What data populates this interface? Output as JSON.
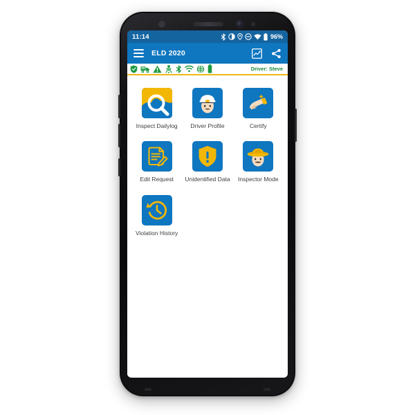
{
  "device": {
    "type": "android-smartphone",
    "frame_color": "#0d0d0f"
  },
  "status_bar": {
    "time": "11:14",
    "battery_percent": "96%",
    "icons": [
      "bluetooth-icon",
      "brightness-icon",
      "location-icon",
      "do-not-disturb-icon",
      "wifi-icon",
      "battery-icon"
    ],
    "background_color": "#1464a0"
  },
  "app_bar": {
    "menu_icon": "hamburger-menu-icon",
    "title": "ELD 2020",
    "actions": [
      {
        "name": "chart-image-icon",
        "label": "Chart"
      },
      {
        "name": "share-icon",
        "label": "Share"
      }
    ],
    "background_color": "#0f76c0"
  },
  "status_strip": {
    "driver_label": "Driver: Steve",
    "accent_color": "#188a3c",
    "divider_color": "#f0b816",
    "icons": [
      {
        "name": "shield-icon",
        "state": "ok"
      },
      {
        "name": "truck-icon",
        "state": "ok"
      },
      {
        "name": "warning-triangle-icon",
        "state": "ok"
      },
      {
        "name": "eld-connection-icon",
        "state": "ok"
      },
      {
        "name": "bluetooth-icon",
        "state": "ok"
      },
      {
        "name": "wifi-icon",
        "state": "ok"
      },
      {
        "name": "globe-icon",
        "state": "ok"
      },
      {
        "name": "battery-icon",
        "state": "ok"
      }
    ]
  },
  "main": {
    "tile_color": "#0f76c0",
    "label_color": "#3d4043",
    "apps": [
      {
        "id": "inspect-dailylog",
        "label": "Inspect Dailylog",
        "icon": "magnifier-document-icon"
      },
      {
        "id": "driver-profile",
        "label": "Driver Profile",
        "icon": "driver-face-icon"
      },
      {
        "id": "certify",
        "label": "Certify",
        "icon": "signing-hand-icon"
      },
      {
        "id": "edit-request",
        "label": "Edit Request",
        "icon": "document-pencil-icon"
      },
      {
        "id": "unidentified-data",
        "label": "Unidentified Data",
        "icon": "shield-exclamation-icon"
      },
      {
        "id": "inspector-mode",
        "label": "Inspector Mode",
        "icon": "sheriff-face-icon"
      },
      {
        "id": "violation-history",
        "label": "Violation History",
        "icon": "clock-history-icon"
      }
    ]
  }
}
